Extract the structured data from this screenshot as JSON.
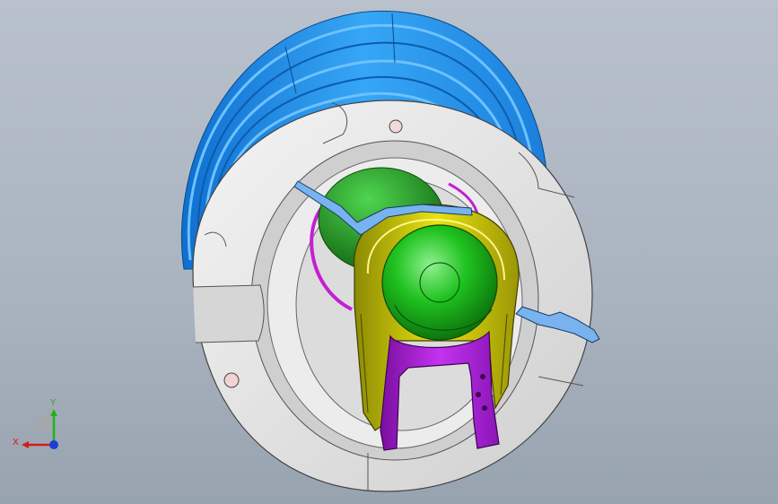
{
  "viewport": {
    "background_top": "#b8c1cc",
    "background_bottom": "#98a3b0"
  },
  "model": {
    "colors": {
      "bellows": "#1e8fe8",
      "housing": "#e4e4e4",
      "clip": "#d8d20a",
      "ball": "#1fc21f",
      "bracket": "#b11ee0",
      "spring_wire": "#6fa9e6",
      "ring": "#c41fd4"
    }
  },
  "triad": {
    "x_label": "X",
    "y_label": "Y",
    "x_color": "#d41c1c",
    "y_color": "#1fb21f",
    "z_color": "#1c3ed4"
  }
}
